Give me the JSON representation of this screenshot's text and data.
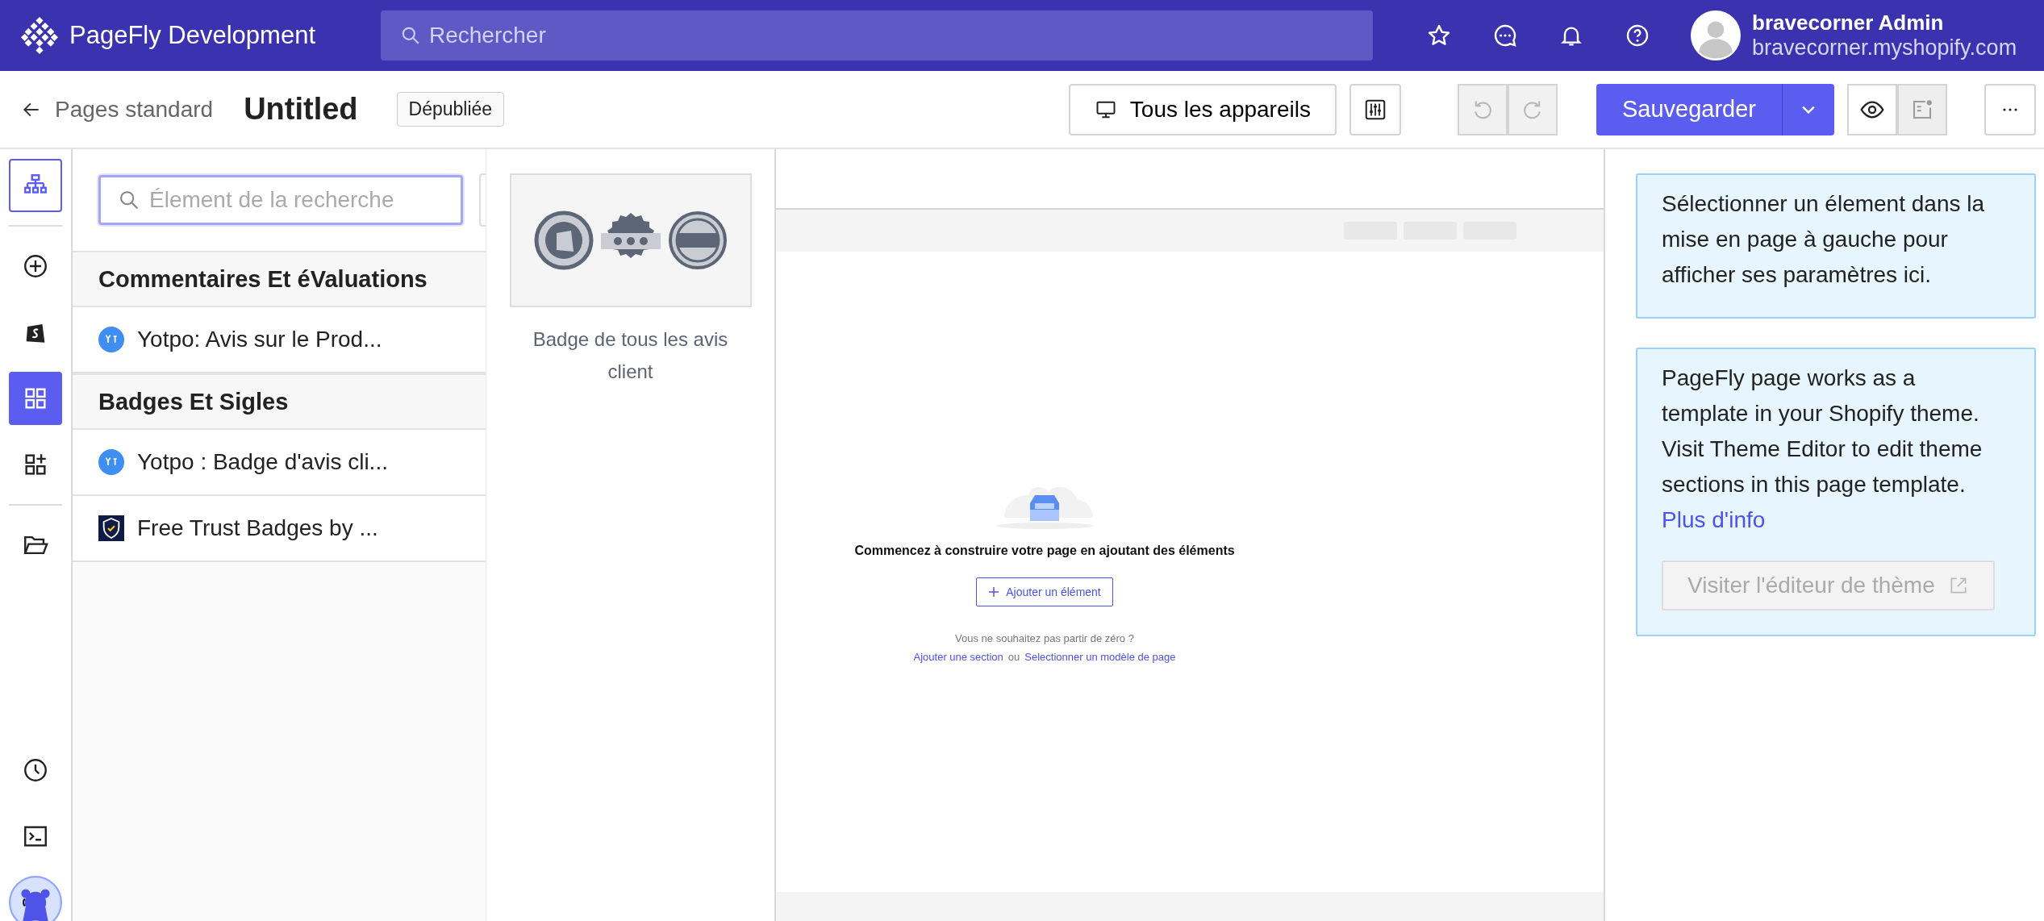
{
  "header": {
    "brand": "PageFly Development",
    "search": {
      "placeholder": "Rechercher"
    },
    "user": {
      "name": "bravecorner Admin",
      "store": "bravecorner.myshopify.com"
    }
  },
  "toolbar": {
    "back": "Pages standard",
    "title": "Untitled",
    "status": "Dépubliée",
    "device": "Tous les appareils",
    "history": [
      {
        "kind": "undo",
        "disabled": true
      },
      {
        "kind": "redo",
        "disabled": true
      }
    ],
    "save": "Sauvegarder"
  },
  "rail": [
    {
      "kind": "layers",
      "selected": false,
      "outlined": true
    },
    {
      "kind": "add",
      "selected": false,
      "outlined": false
    },
    {
      "kind": "shop",
      "selected": false,
      "outlined": false
    },
    {
      "kind": "grid",
      "selected": true,
      "outlined": false
    },
    {
      "kind": "apps",
      "selected": false,
      "outlined": false
    },
    {
      "kind": "folder",
      "selected": false,
      "outlined": false
    },
    {
      "kind": "clock",
      "selected": false,
      "outlined": false
    },
    {
      "kind": "terminal",
      "selected": false,
      "outlined": false
    }
  ],
  "elements": {
    "search": {
      "placeholder": "Élement de la recherche"
    },
    "categories": [
      {
        "title": "Commentaires Et éValuations",
        "items": [
          {
            "label": "Yotpo: Avis sur le Prod...",
            "kind": "yotpo"
          }
        ]
      },
      {
        "title": "Badges Et Sigles",
        "items": [
          {
            "label": "Yotpo : Badge d'avis cli...",
            "kind": "yotpo"
          },
          {
            "label": "Free Trust Badges by ...",
            "kind": "shield"
          }
        ]
      }
    ]
  },
  "preview": {
    "label": "Badge de tous les avis client"
  },
  "canvas": {
    "heading": "Commencez à construire votre page en ajoutant des éléments",
    "add_button": "Ajouter un élément",
    "hint": "Vous ne souhaitez pas partir de zéro ?",
    "link_section": "Ajouter une section",
    "or": "ou",
    "link_template": "Selectionner un modèle de page"
  },
  "inspector": {
    "notice": "Sélectionner un élement dans la mise en page à gauche pour afficher ses paramètres ici.",
    "info": "PageFly page works as a template in your Shopify theme. Visit Theme Editor to edit theme sections in this page template.",
    "link": "Plus d'info",
    "button": {
      "label": "Visiter l'éditeur de thème",
      "disabled": true
    }
  }
}
